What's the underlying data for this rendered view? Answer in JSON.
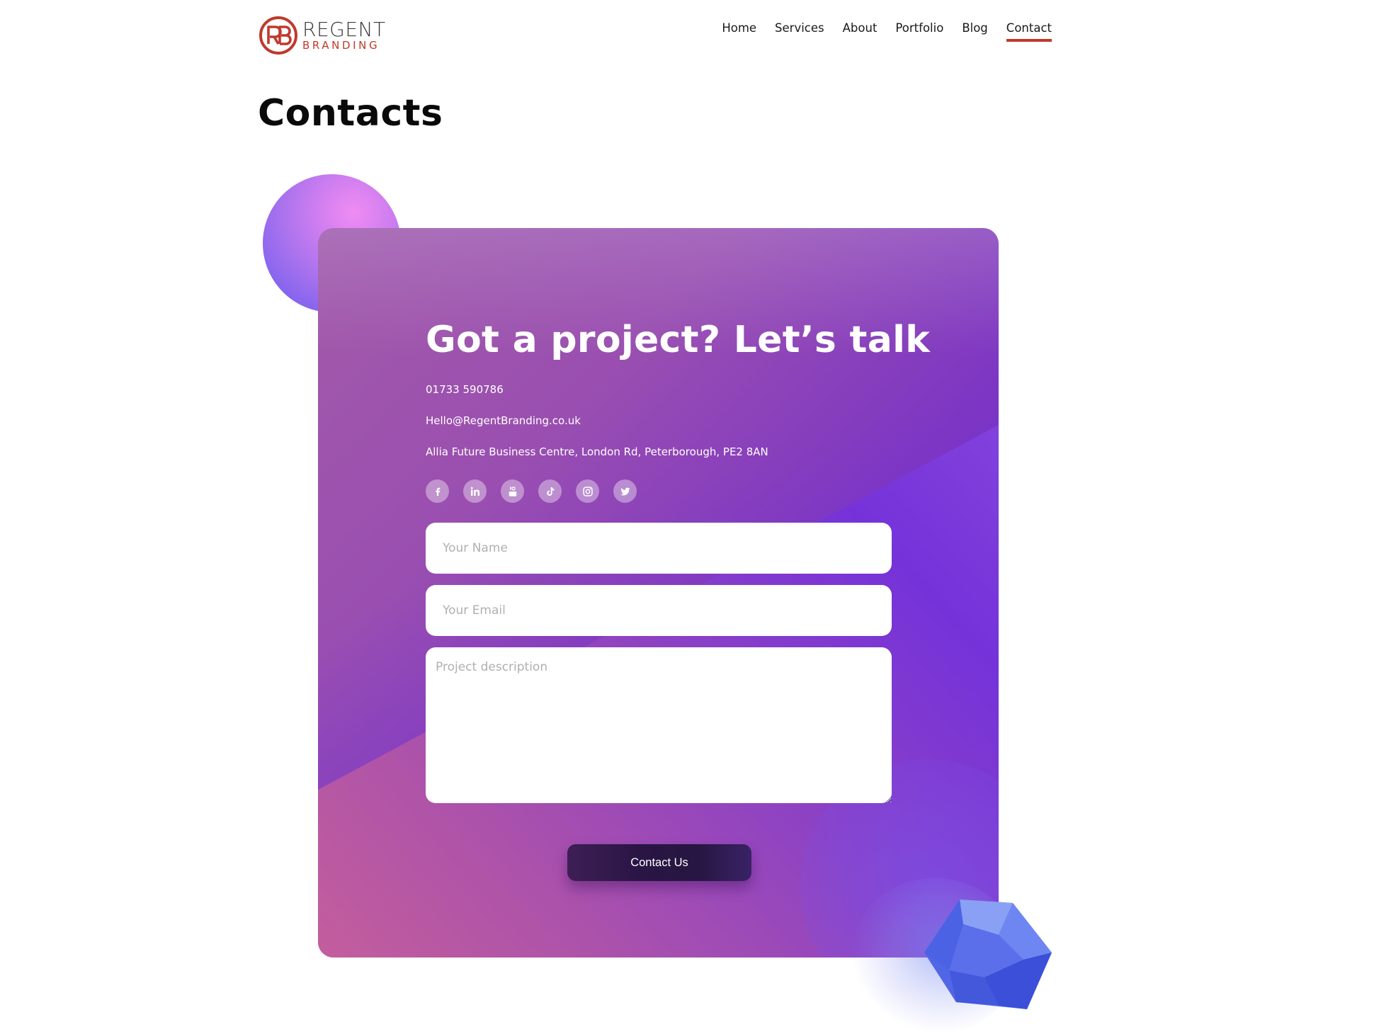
{
  "brand": {
    "name_line1": "REGENT",
    "name_line2": "BRANDING",
    "brand_color": "#c0392b"
  },
  "nav": {
    "items": [
      {
        "label": "Home",
        "active": false
      },
      {
        "label": "Services",
        "active": false
      },
      {
        "label": "About",
        "active": false
      },
      {
        "label": "Portfolio",
        "active": false
      },
      {
        "label": "Blog",
        "active": false
      },
      {
        "label": "Contact",
        "active": true
      }
    ]
  },
  "page": {
    "title": "Contacts"
  },
  "contact_card": {
    "heading": "Got a project? Let’s talk",
    "phone": "01733 590786",
    "email": "Hello@RegentBranding.co.uk",
    "address": "Allia Future Business Centre, London Rd, Peterborough, PE2 8AN",
    "socials": [
      {
        "icon": "facebook-icon"
      },
      {
        "icon": "linkedin-icon"
      },
      {
        "icon": "youtube-icon"
      },
      {
        "icon": "tiktok-icon"
      },
      {
        "icon": "instagram-icon"
      },
      {
        "icon": "twitter-icon"
      }
    ],
    "form": {
      "name_placeholder": "Your Name",
      "name_value": "",
      "email_placeholder": "Your Email",
      "email_value": "",
      "description_placeholder": "Project description",
      "description_value": "",
      "submit_label": "Contact Us"
    },
    "gradient_colors": [
      "#c7609a",
      "#9a4fb0",
      "#7532da",
      "#6f3bd6"
    ]
  },
  "decorations": {
    "orb_color": "#d27ff0",
    "gem_color": "#5b72ee"
  }
}
